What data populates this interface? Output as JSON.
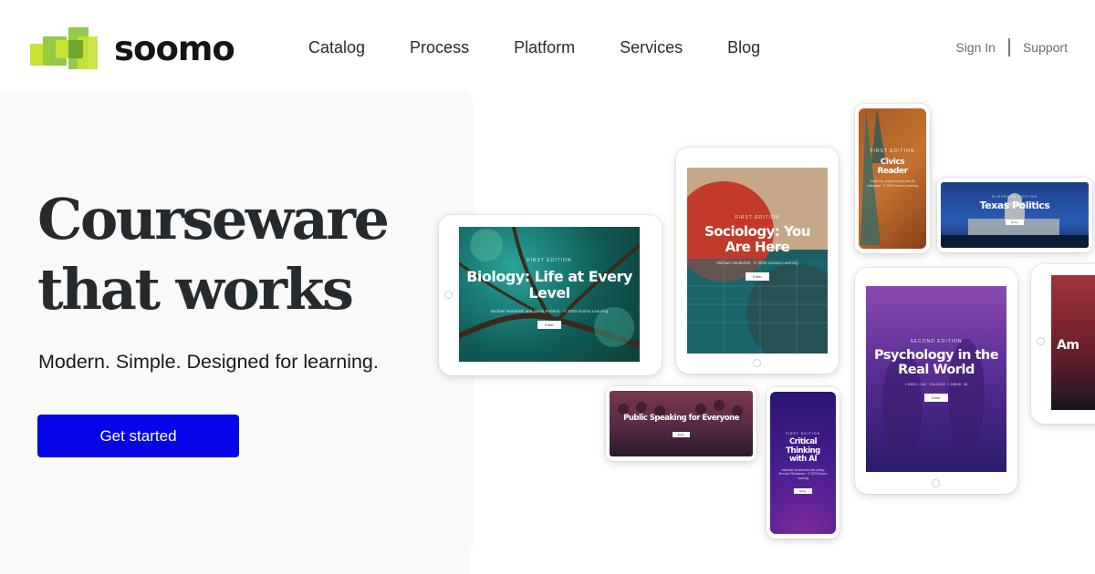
{
  "brand": {
    "name": "soomo",
    "colors": {
      "primary_green": "#8cc63f",
      "light_green": "#c6e234",
      "cta_blue": "#0505e8"
    }
  },
  "nav": {
    "items": [
      "Catalog",
      "Process",
      "Platform",
      "Services",
      "Blog"
    ]
  },
  "utility": {
    "sign_in": "Sign In",
    "support": "Support"
  },
  "hero": {
    "headline_line1": "Courseware",
    "headline_line2": "that works",
    "tagline": "Modern. Simple. Designed for learning.",
    "cta_label": "Get started"
  },
  "books": {
    "biology": {
      "edition": "FIRST EDITION",
      "title": "Biology: Life at Every Level",
      "meta": "Michael Vanderbilt and Jason Roberts · © 2020 Soomo Learning",
      "button": "Enter"
    },
    "sociology": {
      "edition": "FIRST EDITION",
      "title": "Sociology: You Are Here",
      "meta": "Michael Vanderbilt · © 2020 Soomo Learning",
      "button": "Enter"
    },
    "civics": {
      "edition": "FIRST EDITION",
      "title": "Civics Reader",
      "meta": "Edited by Jordan Evans and Jill Gallagher · © 2020 Soomo Learning",
      "button": "Enter"
    },
    "texas": {
      "edition": "ELEVENTH EDITION",
      "title": "Texas Politics",
      "button": "Enter"
    },
    "psychology": {
      "edition": "SECOND EDITION",
      "title": "Psychology in the Real World",
      "meta": "1 WEEK 1 DAY · 2 BLOCKS · 1 MINOR · 88",
      "button": "Enter"
    },
    "public_speaking": {
      "title": "Public Speaking for Everyone",
      "button": "Enter"
    },
    "critical": {
      "edition": "FIRST EDITION",
      "title": "Critical Thinking with AI",
      "meta": "Nathaniel Southworth with Ashley Bhonner Richardson · © 2025 Soomo Learning",
      "button": "Enter"
    },
    "american": {
      "title": "Am"
    }
  }
}
